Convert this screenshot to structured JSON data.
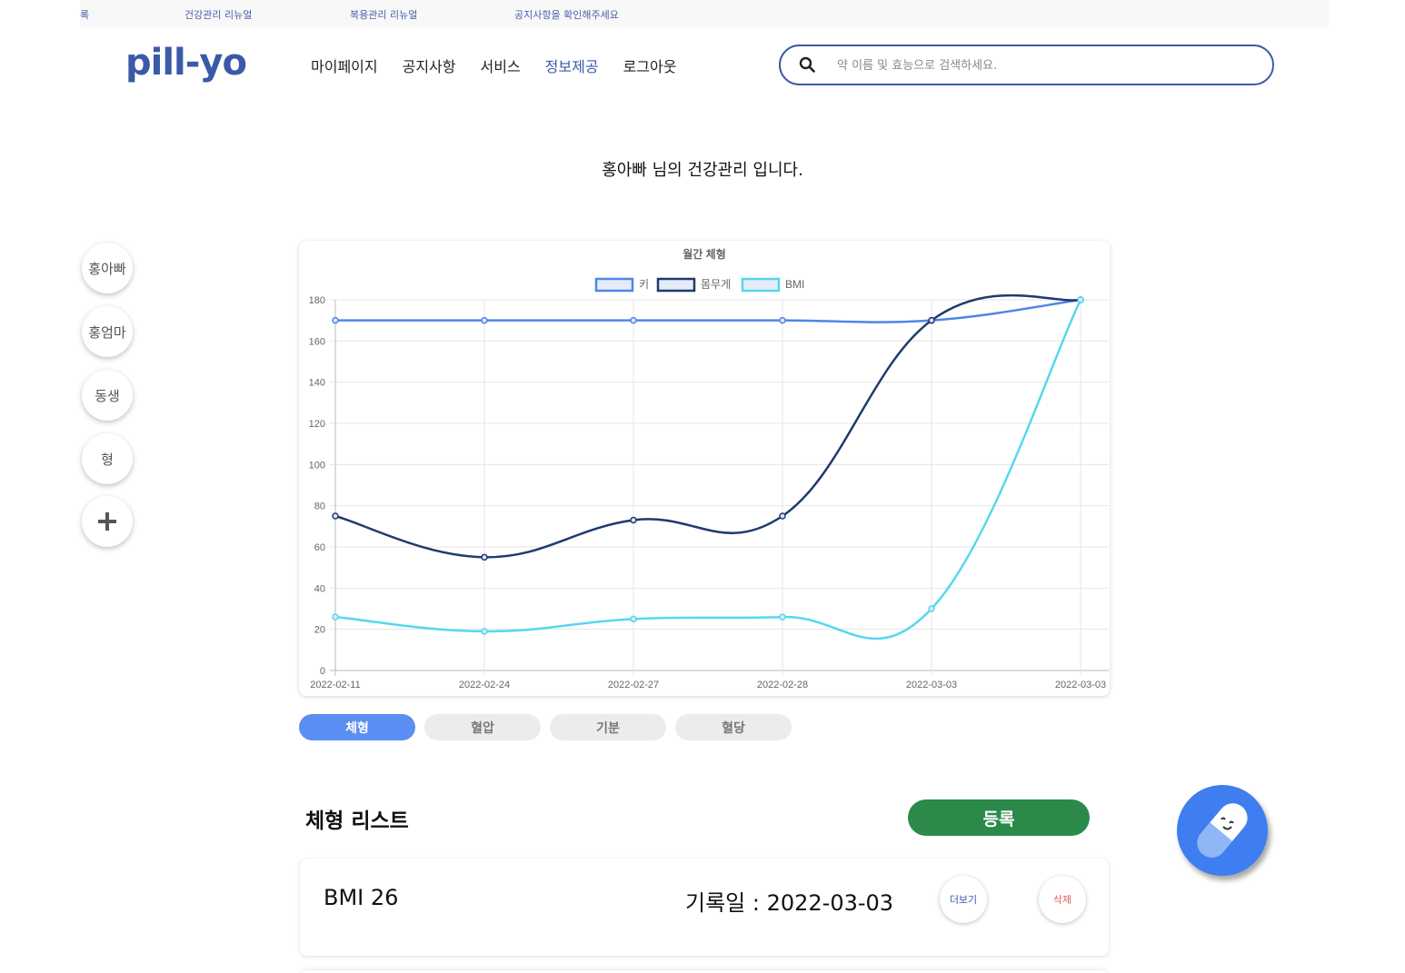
{
  "ticker": [
    "록",
    "건강관리 리뉴얼",
    "복용관리 리뉴얼",
    "공지사항을 확인해주세요"
  ],
  "header": {
    "logo": "pill-yo",
    "nav": [
      "마이페이지",
      "공지사항",
      "서비스",
      "정보제공",
      "로그아웃"
    ],
    "search_placeholder": "약 이름 및 효능으로 검색하세요."
  },
  "greeting": "홍아빠 님의 건강관리 입니다.",
  "profiles": [
    "홍아빠",
    "홍엄마",
    "동생",
    "형"
  ],
  "add_profile_icon": "plus-icon",
  "chart_data": {
    "type": "line",
    "title": "월간 체형",
    "categories": [
      "2022-02-11",
      "2022-02-24",
      "2022-02-27",
      "2022-02-28",
      "2022-03-03",
      "2022-03-03"
    ],
    "ylim": [
      0,
      180
    ],
    "yticks": [
      0,
      20,
      40,
      60,
      80,
      100,
      120,
      140,
      160,
      180
    ],
    "grid": true,
    "legend_position": "top",
    "series": [
      {
        "name": "키",
        "values": [
          170,
          170,
          170,
          170,
          170,
          180
        ],
        "color": "#4f86e8"
      },
      {
        "name": "몸무게",
        "values": [
          75,
          55,
          73,
          75,
          170,
          180
        ],
        "color": "#1f3a6e"
      },
      {
        "name": "BMI",
        "values": [
          26,
          19,
          25,
          26,
          30,
          180
        ],
        "color": "#55d8ee"
      }
    ]
  },
  "tabs": [
    {
      "label": "체형",
      "active": true
    },
    {
      "label": "혈압",
      "active": false
    },
    {
      "label": "기분",
      "active": false
    },
    {
      "label": "혈당",
      "active": false
    }
  ],
  "list": {
    "title": "체형 리스트",
    "register_label": "등록",
    "records": [
      {
        "name": "BMI 26",
        "date": "기록일 : 2022-03-03",
        "more_label": "더보기",
        "delete_label": "삭제"
      }
    ]
  },
  "colors": {
    "brand": "#3a5aa8",
    "tab_active": "#5a8ef2",
    "register": "#2b8a4a",
    "delete": "#e05a5a",
    "fab": "#3f7ef0"
  },
  "fab_icon": "pill-mascot-icon"
}
